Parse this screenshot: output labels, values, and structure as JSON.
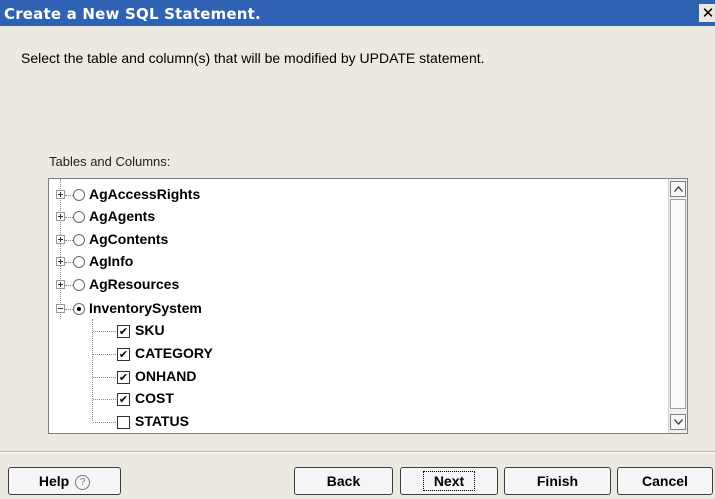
{
  "window": {
    "title": "Create a New SQL Statement.",
    "close_glyph": "✕"
  },
  "instruction": "Select the table and column(s) that will be modified by UPDATE statement.",
  "tree": {
    "label": "Tables and Columns:",
    "tables": [
      {
        "name": "AgAccessRights",
        "expanded": false,
        "selected": false
      },
      {
        "name": "AgAgents",
        "expanded": false,
        "selected": false
      },
      {
        "name": "AgContents",
        "expanded": false,
        "selected": false
      },
      {
        "name": "AgInfo",
        "expanded": false,
        "selected": false
      },
      {
        "name": "AgResources",
        "expanded": false,
        "selected": false
      },
      {
        "name": "InventorySystem",
        "expanded": true,
        "selected": true
      }
    ],
    "columns": [
      {
        "name": "SKU",
        "checked": true
      },
      {
        "name": "CATEGORY",
        "checked": true
      },
      {
        "name": "ONHAND",
        "checked": true
      },
      {
        "name": "COST",
        "checked": true
      },
      {
        "name": "STATUS",
        "checked": false
      }
    ]
  },
  "buttons": {
    "help": "Help",
    "help_icon": "?",
    "back": "Back",
    "next": "Next",
    "finish": "Finish",
    "cancel": "Cancel"
  },
  "colors": {
    "titlebar": "#2f62b3",
    "dialog_bg": "#ece9e1"
  }
}
